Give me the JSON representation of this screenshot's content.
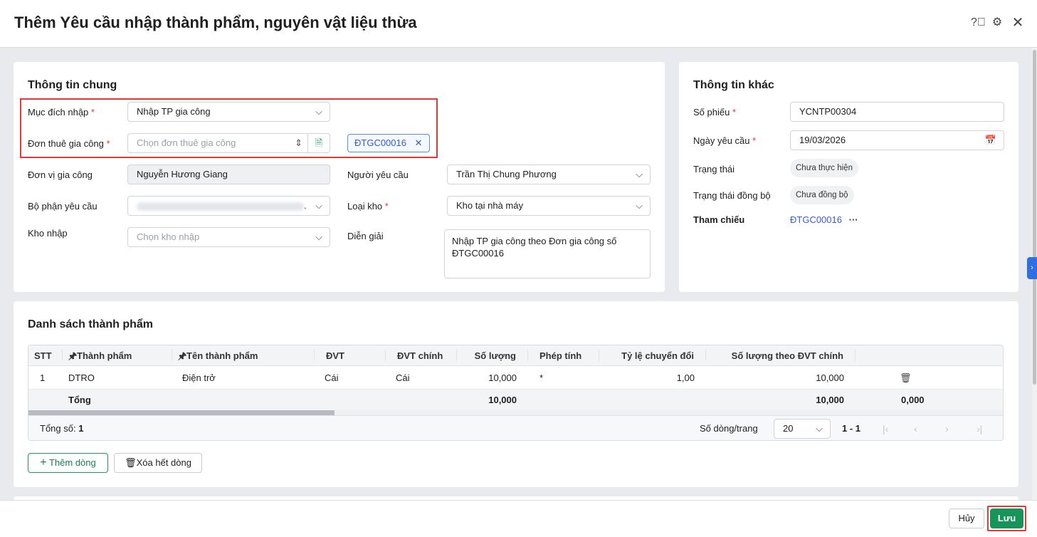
{
  "header": {
    "title": "Thêm Yêu cầu nhập thành phẩm, nguyên vật liệu thừa"
  },
  "general": {
    "title": "Thông tin chung",
    "purpose_label": "Mục đích nhập",
    "purpose_value": "Nhập TP gia công",
    "order_label": "Đơn thuê gia công",
    "order_placeholder": "Chọn đơn thuê gia công",
    "order_tag": "ĐTGC00016",
    "processor_label": "Đơn vị gia công",
    "processor_value": "Nguyễn Hương Giang",
    "requester_label": "Người yêu cầu",
    "requester_value": "Trần Thị Chung Phương",
    "dept_label": "Bộ phận yêu cầu",
    "dept_value": ".",
    "warehouse_type_label": "Loại kho",
    "warehouse_type_value": "Kho tại nhà máy",
    "warehouse_label": "Kho nhập",
    "warehouse_placeholder": "Chọn kho nhập",
    "desc_label": "Diễn giải",
    "desc_value": "Nhập TP gia công theo Đơn gia công số ĐTGC00016"
  },
  "other": {
    "title": "Thông tin khác",
    "number_label": "Số phiếu",
    "number_value": "YCNTP00304",
    "date_label": "Ngày yêu cầu",
    "date_value": "19/03/2026",
    "status_label": "Trạng thái",
    "status_value": "Chưa thực hiện",
    "sync_label": "Trạng thái đồng bộ",
    "sync_value": "Chưa đồng bộ",
    "ref_label": "Tham chiếu",
    "ref_value": "ĐTGC00016"
  },
  "products": {
    "title": "Danh sách thành phẩm",
    "columns": [
      "STT",
      "Thành phẩm",
      "Tên thành phẩm",
      "ĐVT",
      "ĐVT chính",
      "Số lượng",
      "Phép tính",
      "Tỷ lệ chuyển đổi",
      "Số lượng theo ĐVT chính"
    ],
    "rows": [
      {
        "stt": "1",
        "code": "DTRO",
        "name": "Điện trở",
        "unit": "Cái",
        "main_unit": "Cái",
        "qty": "10,000",
        "op": "*",
        "rate": "1,00",
        "main_qty": "10,000"
      }
    ],
    "total": {
      "label": "Tổng",
      "qty": "10,000",
      "main_qty": "10,000",
      "extra": "0,000"
    },
    "count_label": "Tổng số:",
    "count": "1",
    "page_size_label": "Số dòng/trang",
    "page_size": "20",
    "range": "1 - 1",
    "add_row": "Thêm dòng",
    "clear_rows": "Xóa hết dòng"
  },
  "footer": {
    "cancel": "Hủy",
    "save": "Lưu"
  }
}
